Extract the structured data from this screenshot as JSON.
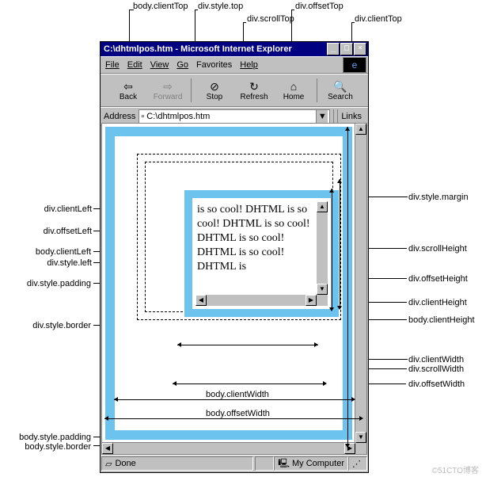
{
  "labels": {
    "body_clientTop": "body.clientTop",
    "div_style_top": "div.style.top",
    "div_scrollTop": "div.scrollTop",
    "div_offsetTop": "div.offsetTop",
    "div_clientTop": "div.clientTop",
    "div_clientLeft": "div.clientLeft",
    "div_offsetLeft": "div.offsetLeft",
    "body_clientLeft": "body.clientLeft",
    "div_style_left": "div.style.left",
    "div_style_padding": "div.style.padding",
    "div_style_border": "div.style.border",
    "body_style_padding": "body.style.padding",
    "body_style_border": "body.style.border",
    "div_style_margin": "div.style.margin",
    "div_scrollHeight": "div.scrollHeight",
    "div_offsetHeight": "div.offsetHeight",
    "div_clientHeight": "div.clientHeight",
    "body_clientHeight": "body.clientHeight",
    "div_clientWidth": "div.clientWidth",
    "div_scrollWidth": "div.scrollWidth",
    "div_offsetWidth": "div.offsetWidth",
    "body_clientWidth": "body.clientWidth",
    "body_offsetWidth": "body.offsetWidth"
  },
  "window": {
    "title": "C:\\dhtmlpos.htm - Microsoft Internet Explorer",
    "menu": {
      "file": "File",
      "edit": "Edit",
      "view": "View",
      "go": "Go",
      "favorites": "Favorites",
      "help": "Help"
    },
    "toolbar": {
      "back": "Back",
      "forward": "Forward",
      "stop": "Stop",
      "refresh": "Refresh",
      "home": "Home",
      "search": "Search"
    },
    "address_label": "Address",
    "address_value": "C:\\dhtmlpos.htm",
    "links": "Links",
    "status_done": "Done",
    "status_zone": "My Computer"
  },
  "content_text": "is so cool! DHTML is so cool! DHTML is so cool! DHTML is so cool! DHTML is so cool! DHTML is",
  "watermark": "©51CTO博客"
}
